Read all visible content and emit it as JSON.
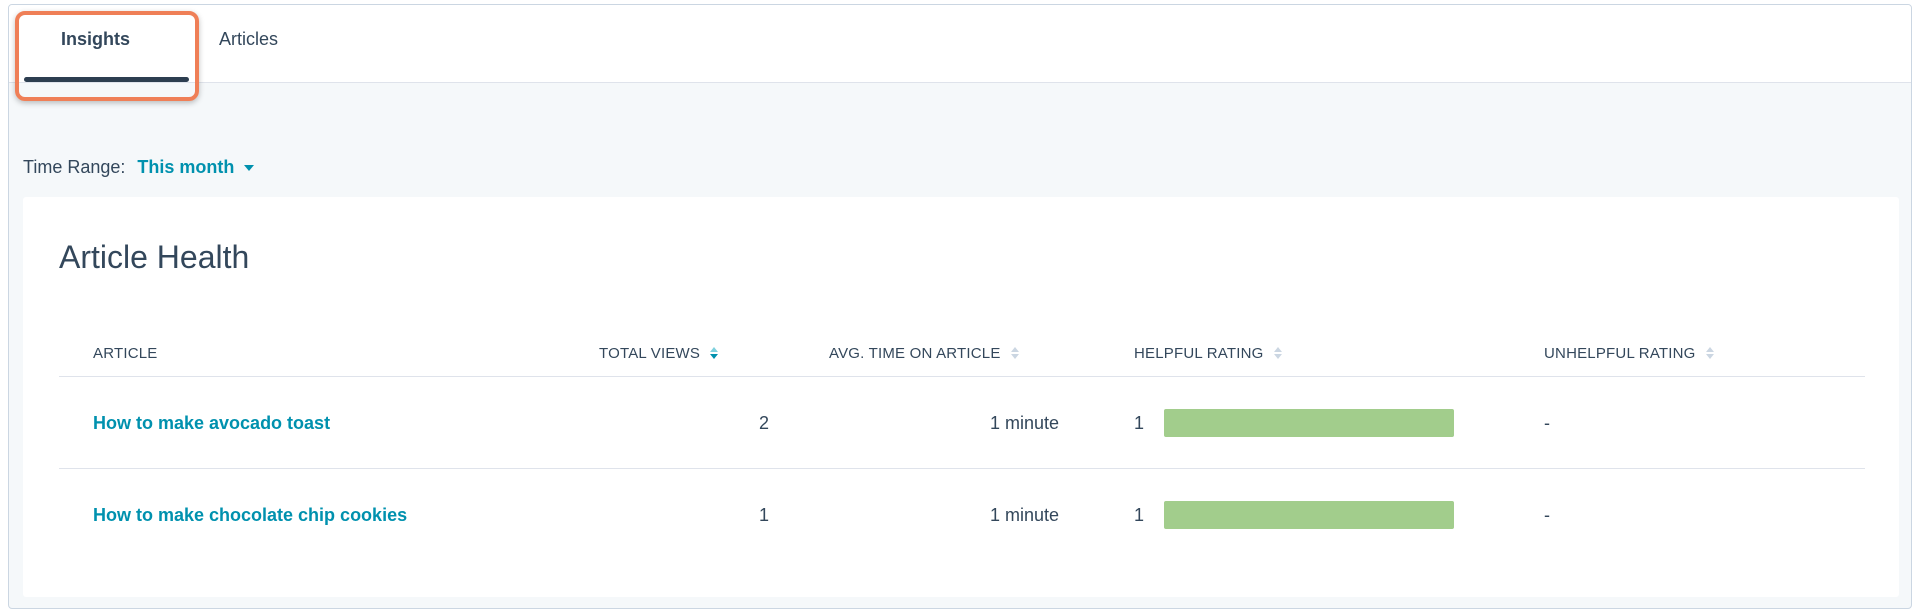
{
  "tabs": [
    {
      "label": "Insights",
      "active": true
    },
    {
      "label": "Articles",
      "active": false
    }
  ],
  "time_range": {
    "label": "Time Range:",
    "value": "This month"
  },
  "card": {
    "title": "Article Health"
  },
  "table": {
    "columns": {
      "article": "ARTICLE",
      "views": "TOTAL VIEWS",
      "time": "AVG. TIME ON ARTICLE",
      "helpful": "HELPFUL RATING",
      "unhelpful": "UNHELPFUL RATING"
    },
    "sorted_by": "TOTAL VIEWS",
    "rows": [
      {
        "article": "How to make avocado toast",
        "views": "2",
        "time": "1 minute",
        "helpful": "1",
        "helpful_fraction": 1.0,
        "unhelpful": "-"
      },
      {
        "article": "How to make chocolate chip cookies",
        "views": "1",
        "time": "1 minute",
        "helpful": "1",
        "helpful_fraction": 1.0,
        "unhelpful": "-"
      }
    ]
  },
  "colors": {
    "accent_link": "#0091ae",
    "bar_fill": "#a2cd8c",
    "highlight_outline": "#ef7f57",
    "tab_underline": "#2d3e50"
  }
}
